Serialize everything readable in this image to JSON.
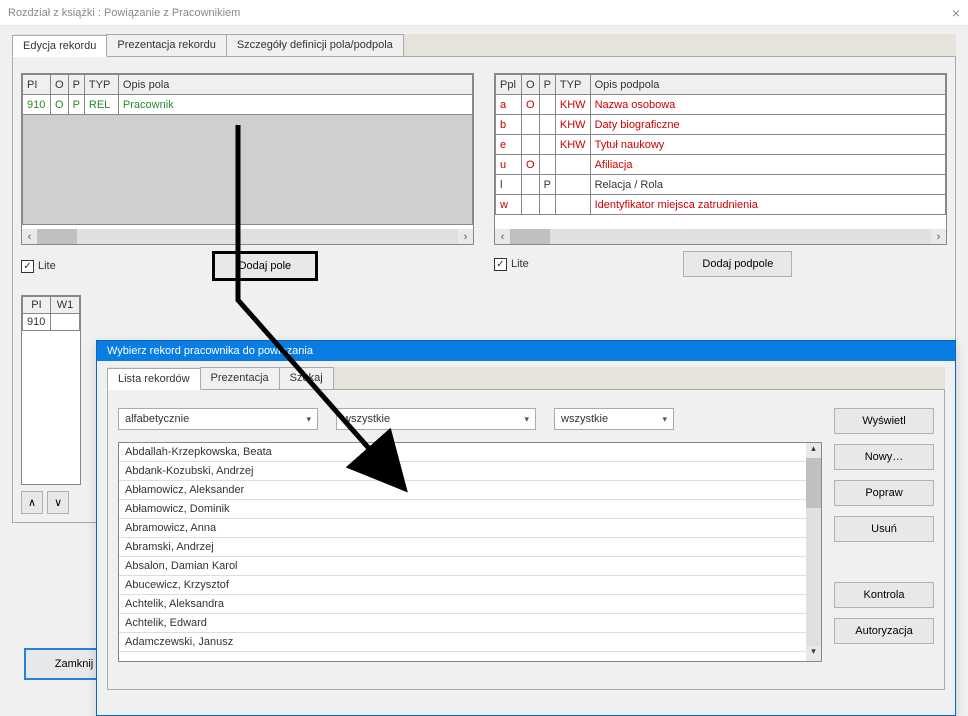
{
  "window": {
    "title": "Rozdział z książki : Powiązanie z Pracownikiem"
  },
  "tabs": {
    "t1": "Edycja rekordu",
    "t2": "Prezentacja rekordu",
    "t3": "Szczegóły definicji pola/podpola"
  },
  "left_table": {
    "headers": {
      "c1": "PI",
      "c2": "O",
      "c3": "P",
      "c4": "TYP",
      "c5": "Opis pola"
    },
    "row": {
      "c1": "910",
      "c2": "O",
      "c3": "P",
      "c4": "REL",
      "c5": "Pracownik"
    }
  },
  "right_table": {
    "headers": {
      "c1": "Ppl",
      "c2": "O",
      "c3": "P",
      "c4": "TYP",
      "c5": "Opis podpola"
    },
    "rows": [
      {
        "c1": "a",
        "c2": "O",
        "c3": "",
        "c4": "KHW",
        "c5": "Nazwa osobowa",
        "red": true
      },
      {
        "c1": "b",
        "c2": "",
        "c3": "",
        "c4": "KHW",
        "c5": "Daty biograficzne",
        "red": true
      },
      {
        "c1": "e",
        "c2": "",
        "c3": "",
        "c4": "KHW",
        "c5": "Tytuł naukowy",
        "red": true
      },
      {
        "c1": "u",
        "c2": "O",
        "c3": "",
        "c4": "",
        "c5": "Afiliacja",
        "red": true
      },
      {
        "c1": "l",
        "c2": "",
        "c3": "P",
        "c4": "",
        "c5": "Relacja / Rola",
        "red": false
      },
      {
        "c1": "w",
        "c2": "",
        "c3": "",
        "c4": "",
        "c5": "Identyfikator miejsca zatrudnienia",
        "red": true
      }
    ]
  },
  "checkboxes": {
    "lite_left": "Lite",
    "lite_right": "Lite"
  },
  "buttons": {
    "dodaj_pole": "Dodaj pole",
    "dodaj_podpole": "Dodaj podpole",
    "zamknij": "Zamknij",
    "wyswietl": "Wyświetl",
    "nowy": "Nowy…",
    "popraw": "Popraw",
    "usun": "Usuń",
    "kontrola": "Kontrola",
    "autoryzacja": "Autoryzacja"
  },
  "lower_table": {
    "headers": {
      "c1": "PI",
      "c2": "W1"
    },
    "row": {
      "c1": "910",
      "c2": ""
    }
  },
  "mini_buttons": {
    "up": "∧",
    "down": "∨"
  },
  "modal": {
    "title": "Wybierz rekord pracownika do powiązania",
    "tabs": {
      "t1": "Lista rekordów",
      "t2": "Prezentacja",
      "t3": "Szukaj"
    },
    "filters": {
      "sort": "alfabetycznie",
      "f2": "wszystkie",
      "f3": "wszystkie"
    },
    "list": [
      "Abdallah-Krzepkowska, Beata",
      "Abdank-Kozubski, Andrzej",
      "Abłamowicz, Aleksander",
      "Abłamowicz, Dominik",
      "Abramowicz, Anna",
      "Abramski, Andrzej",
      "Absalon, Damian Karol",
      "Abucewicz, Krzysztof",
      "Achtelik, Aleksandra",
      "Achtelik, Edward",
      "Adamczewski, Janusz"
    ]
  }
}
